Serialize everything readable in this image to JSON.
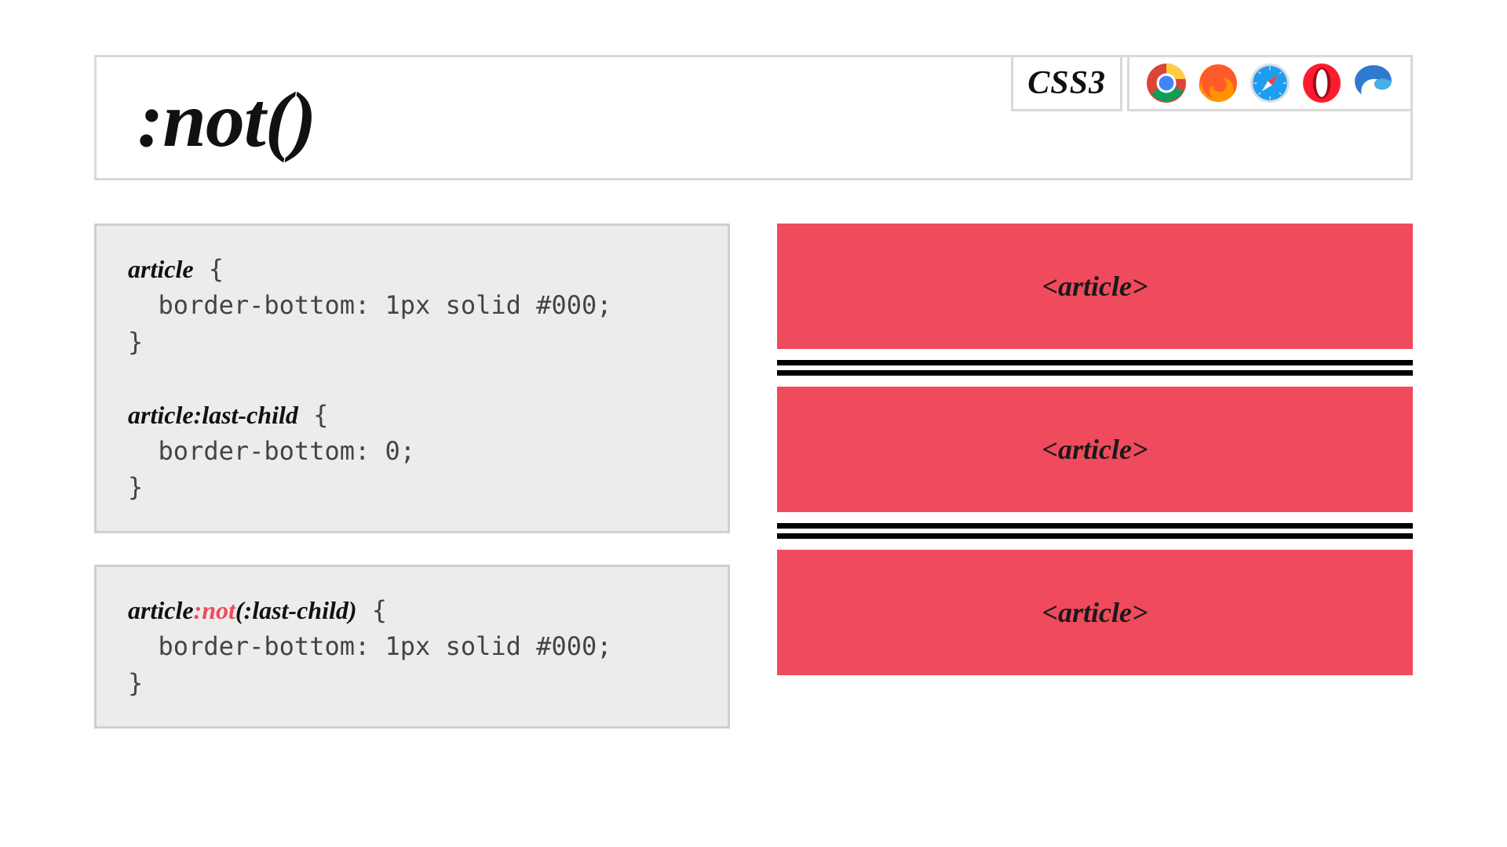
{
  "title": ":not()",
  "spec_label": "CSS3",
  "browsers": [
    "chrome-icon",
    "firefox-icon",
    "safari-icon",
    "opera-icon",
    "edge-icon"
  ],
  "code1": {
    "sel1": "article",
    "body1": "  border-bottom: 1px solid #000;",
    "sel2": "article:last-child",
    "body2": "  border-bottom: 0;"
  },
  "code2": {
    "sel_pre": "article",
    "sel_hl": ":not",
    "sel_post": "(:last-child)",
    "body": "  border-bottom: 1px solid #000;"
  },
  "article_label": "<article>",
  "colors": {
    "article_bg": "#f04a5d",
    "code_bg": "#ececec",
    "border": "#d9d9d9"
  }
}
